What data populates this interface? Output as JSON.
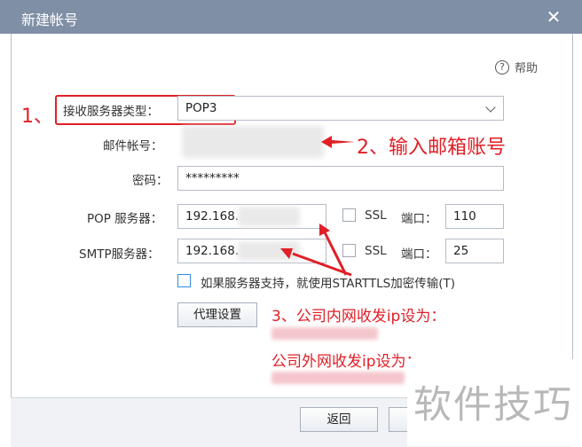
{
  "dialog": {
    "title": "新建帐号",
    "close_glyph": "✕"
  },
  "help": {
    "icon_glyph": "?",
    "label": "帮助"
  },
  "form": {
    "server_type_label": "接收服务器类型：",
    "server_type_value": "POP3",
    "email_label": "邮件帐号：",
    "password_label": "密码：",
    "password_value": "*********",
    "pop_label": "POP 服务器：",
    "pop_value": "192.168.",
    "pop_ssl_label": "SSL",
    "pop_port_label": "端口：",
    "pop_port_value": "110",
    "smtp_label": "SMTP服务器：",
    "smtp_value": "192.168.",
    "smtp_ssl_label": "SSL",
    "smtp_port_label": "端口：",
    "smtp_port_value": "25",
    "starttls_label": "如果服务器支持，就使用STARTTLS加密传输(T)",
    "proxy_button": "代理设置"
  },
  "footer": {
    "back_button": "返回"
  },
  "annotations": {
    "step1": "1、",
    "step2": "2、输入邮箱账号",
    "step3": "3、公司内网收发ip设为：",
    "step3b": "公司外网收发ip设为：",
    "accent_color": "#e01f26"
  },
  "watermark": "软件技巧"
}
